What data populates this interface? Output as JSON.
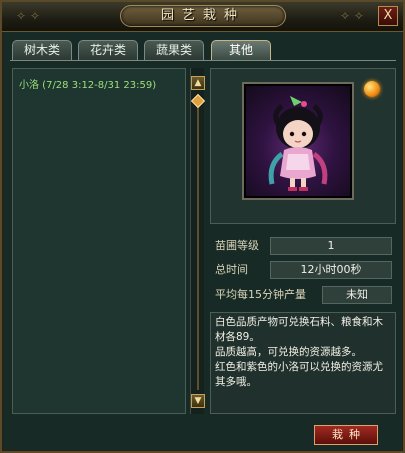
{
  "window": {
    "title": "园艺栽种",
    "close_label": "X"
  },
  "tabs": [
    {
      "label": "树木类",
      "active": false
    },
    {
      "label": "花卉类",
      "active": false
    },
    {
      "label": "蔬果类",
      "active": false
    },
    {
      "label": "其他",
      "active": true
    }
  ],
  "list": {
    "items": [
      {
        "label": "小洛 (7/28 3:12-8/31 23:59)"
      }
    ]
  },
  "scroll": {
    "up_icon": "arrow-up-icon",
    "down_icon": "arrow-down-icon"
  },
  "stats": {
    "nursery_level": {
      "label": "苗圃等级",
      "value": "1"
    },
    "total_time": {
      "label": "总时间",
      "value": "12小时00秒"
    },
    "avg_yield": {
      "label": "平均每15分钟产量",
      "value": "未知"
    }
  },
  "description": {
    "lines": [
      "白色品质产物可兑换石料、粮食和木材各89。",
      "品质越高，可兑换的资源越多。",
      "红色和紫色的小洛可以兑换的资源尤其多哦。"
    ]
  },
  "actions": {
    "plant_label": "栽种"
  },
  "colors": {
    "list_text": "#9be07a",
    "accent_gold": "#c3a15a",
    "button_red": "#a02a22",
    "portrait_bg": "#5d2a72"
  }
}
